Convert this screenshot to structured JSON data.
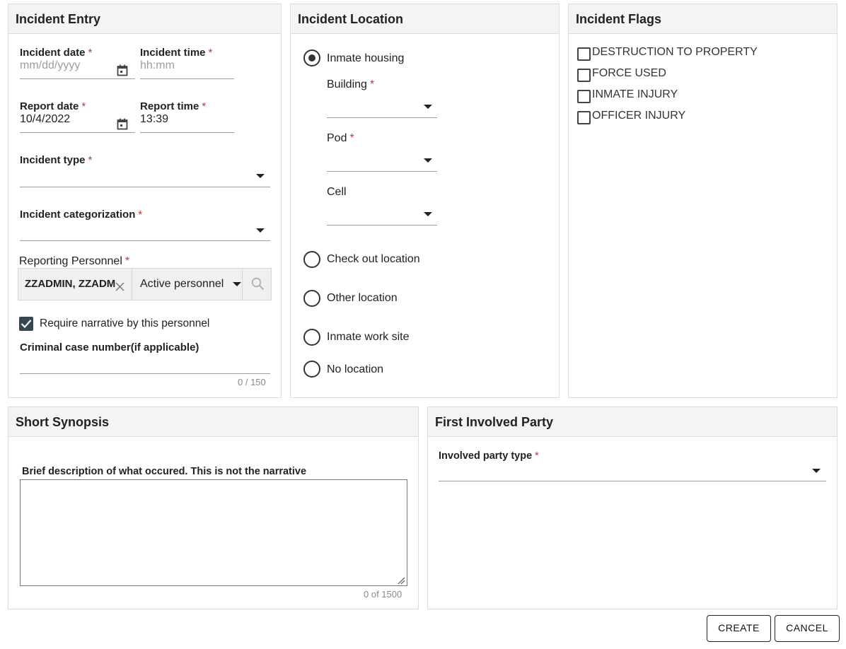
{
  "incident_entry": {
    "title": "Incident Entry",
    "incident_date": {
      "label": "Incident date",
      "placeholder": "mm/dd/yyyy"
    },
    "incident_time": {
      "label": "Incident time",
      "placeholder": "hh:mm"
    },
    "report_date": {
      "label": "Report date",
      "value": "10/4/2022"
    },
    "report_time": {
      "label": "Report time",
      "value": "13:39"
    },
    "incident_type": {
      "label": "Incident type"
    },
    "incident_categorization": {
      "label": "Incident categorization"
    },
    "reporting_personnel": {
      "label": "Reporting Personnel",
      "value": "ZZADMIN, ZZADM",
      "filter": "Active personnel"
    },
    "require_narrative": {
      "label": "Require narrative by this personnel",
      "checked": true
    },
    "criminal_case": {
      "label": "Criminal case number(if applicable)",
      "counter": "0 / 150"
    }
  },
  "incident_location": {
    "title": "Incident Location",
    "options": [
      {
        "label": "Inmate housing",
        "selected": true
      },
      {
        "label": "Check out location",
        "selected": false
      },
      {
        "label": "Other location",
        "selected": false
      },
      {
        "label": "Inmate work site",
        "selected": false
      },
      {
        "label": "No location",
        "selected": false
      }
    ],
    "building": {
      "label": "Building"
    },
    "pod": {
      "label": "Pod"
    },
    "cell": {
      "label": "Cell"
    }
  },
  "incident_flags": {
    "title": "Incident Flags",
    "flags": [
      {
        "label": "DESTRUCTION TO PROPERTY",
        "checked": false
      },
      {
        "label": "FORCE USED",
        "checked": false
      },
      {
        "label": "INMATE INJURY",
        "checked": false
      },
      {
        "label": "OFFICER INJURY",
        "checked": false
      }
    ]
  },
  "short_synopsis": {
    "title": "Short Synopsis",
    "label": "Brief description of what occured. This is not the narrative",
    "counter": "0 of 1500"
  },
  "first_involved_party": {
    "title": "First Involved Party",
    "party_type": {
      "label": "Involved party type"
    }
  },
  "required_marker": "*",
  "actions": {
    "create": "CREATE",
    "cancel": "CANCEL"
  },
  "colors": {
    "required": "#d32f2f",
    "header_bg": "#f4f4f4",
    "checkbox_fill": "#37474f"
  }
}
